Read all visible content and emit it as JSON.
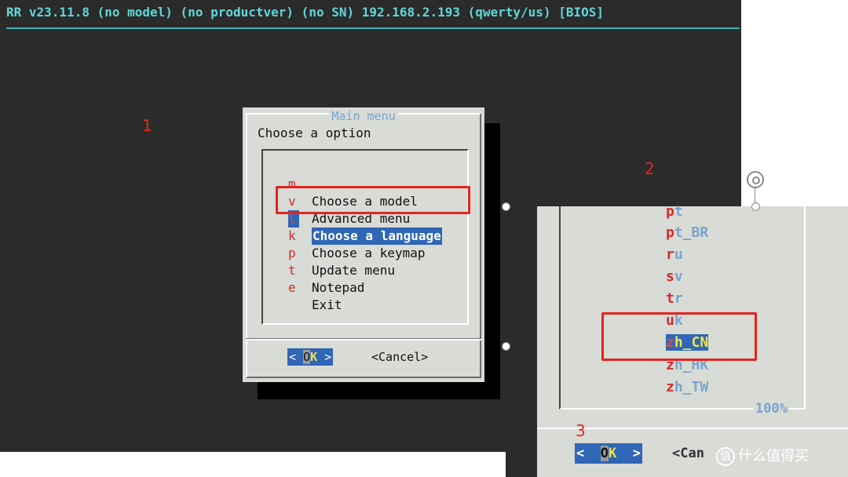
{
  "terminal": {
    "title": "RR v23.11.8 (no model) (no productver) (no SN) 192.168.2.193 (qwerty/us) [BIOS]"
  },
  "annotations": {
    "step1": "1",
    "step2": "2",
    "step3": "3"
  },
  "main_menu": {
    "title": "Main menu",
    "prompt": "Choose a option",
    "items": [
      {
        "key": "m",
        "label": "Choose a model"
      },
      {
        "key": "v",
        "label": "Advanced menu"
      },
      {
        "key": "l",
        "label": "Choose a language",
        "selected": true
      },
      {
        "key": "k",
        "label": "Choose a keymap"
      },
      {
        "key": "p",
        "label": "Update menu"
      },
      {
        "key": "t",
        "label": "Notepad"
      },
      {
        "key": "e",
        "label": "Exit"
      }
    ],
    "ok_label": {
      "left": "<",
      "cursor": "O",
      "hot": "K",
      "right": ">"
    },
    "cancel_label": "<Cancel>"
  },
  "language_menu": {
    "items": [
      {
        "first": "p",
        "rest": "t"
      },
      {
        "first": "p",
        "rest": "t_BR"
      },
      {
        "first": "r",
        "rest": "u"
      },
      {
        "first": "s",
        "rest": "v"
      },
      {
        "first": "t",
        "rest": "r"
      },
      {
        "first": "u",
        "rest": "k"
      },
      {
        "first": "z",
        "rest": "h_CN",
        "selected": true
      },
      {
        "first": "z",
        "rest": "h_HK"
      },
      {
        "first": "z",
        "rest": "h_TW"
      }
    ],
    "scroll_percent": "100%",
    "ok_label": {
      "left": "<",
      "cursor": "O",
      "hot": "K",
      "right": ">"
    },
    "cancel_label": "<Can"
  },
  "watermark": {
    "badge": "值",
    "text": "什么值得买"
  },
  "colors": {
    "terminal_bg": "#2b2b2b",
    "title_cyan": "#5fd7d7",
    "dialog_bg": "#d8dbd6",
    "selection_blue": "#2f66b6",
    "hotkey_red": "#d62a2a",
    "highlight_red": "#e3251f"
  }
}
